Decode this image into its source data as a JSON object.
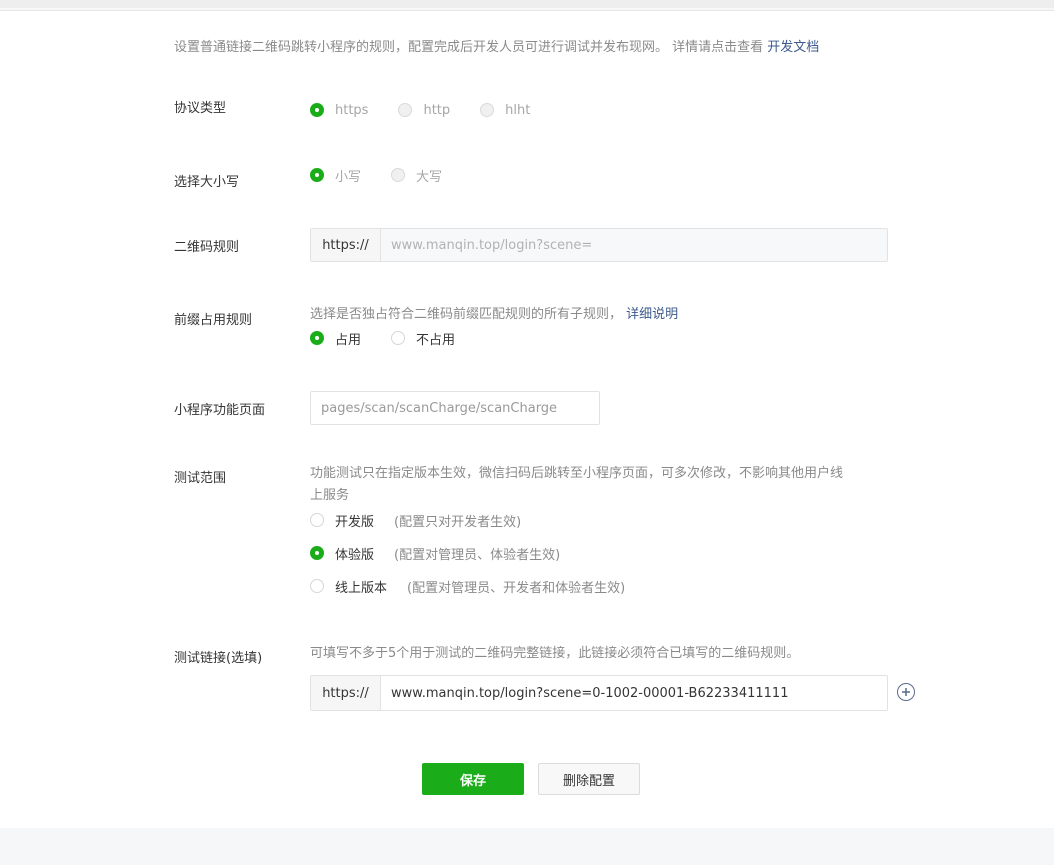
{
  "intro": {
    "text": "设置普通链接二维码跳转小程序的规则，配置完成后开发人员可进行调试并发布现网。 详情请点击查看 ",
    "link": "开发文档"
  },
  "protocol": {
    "label": "协议类型",
    "options": [
      "https",
      "http",
      "hlht"
    ],
    "selected": "https"
  },
  "case": {
    "label": "选择大小写",
    "options": [
      "小写",
      "大写"
    ],
    "selected": "小写"
  },
  "qr_rule": {
    "label": "二维码规则",
    "prefix": "https://",
    "value": "www.manqin.top/login?scene="
  },
  "prefix_rule": {
    "label": "前缀占用规则",
    "desc": "选择是否独占符合二维码前缀匹配规则的所有子规则， ",
    "link": "详细说明",
    "options": [
      "占用",
      "不占用"
    ],
    "selected": "占用"
  },
  "page": {
    "label": "小程序功能页面",
    "value": "pages/scan/scanCharge/scanCharge"
  },
  "test_scope": {
    "label": "测试范围",
    "desc_line1": "功能测试只在指定版本生效，微信扫码后跳转至小程序页面，可多次修改，不影响其他用户线",
    "desc_line2": "上服务",
    "options": [
      {
        "label": "开发版",
        "note": "(配置只对开发者生效)"
      },
      {
        "label": "体验版",
        "note": "(配置对管理员、体验者生效)"
      },
      {
        "label": "线上版本",
        "note": "(配置对管理员、开发者和体验者生效)"
      }
    ],
    "selected": "体验版"
  },
  "test_link": {
    "label": "测试链接(选填)",
    "desc": "可填写不多于5个用于测试的二维码完整链接，此链接必须符合已填写的二维码规则。",
    "prefix": "https://",
    "value": "www.manqin.top/login?scene=0-1002-00001-B62233411111",
    "add_icon": "plus-circle-icon"
  },
  "actions": {
    "save": "保存",
    "delete": "删除配置"
  },
  "colors": {
    "accent": "#1aad19",
    "link": "#3c5a8c"
  }
}
